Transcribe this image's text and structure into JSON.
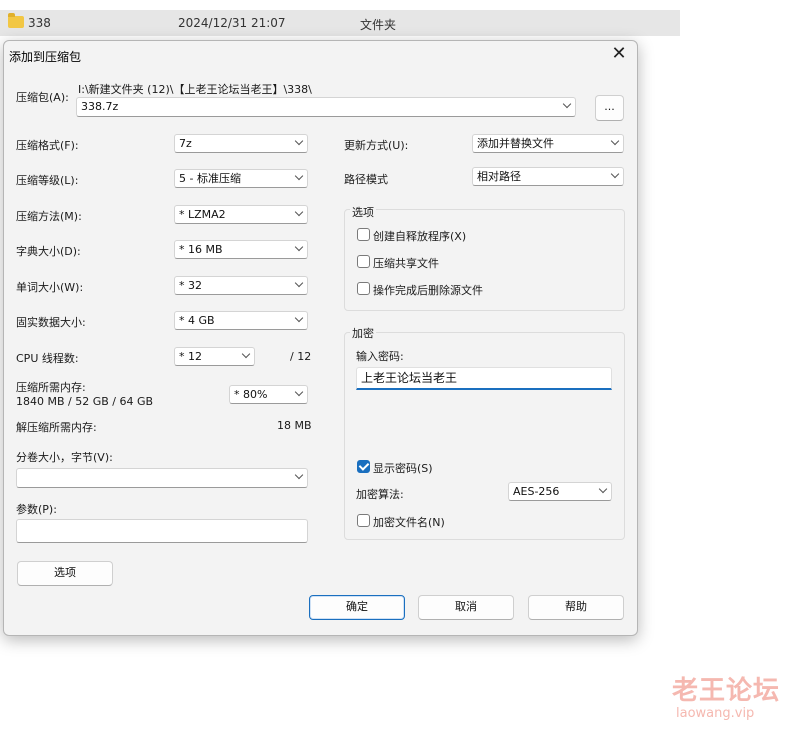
{
  "explorer": {
    "name": "338",
    "date": "2024/12/31 21:07",
    "type": "文件夹"
  },
  "dialog": {
    "title": "添加到压缩包",
    "archive_label": "压缩包(A):",
    "archive_path": "I:\\新建文件夹 (12)\\【上老王论坛当老王】\\338\\",
    "archive_name": "338.7z",
    "browse_label": "...",
    "left": {
      "format_label": "压缩格式(F):",
      "format_value": "7z",
      "level_label": "压缩等级(L):",
      "level_value": "5 - 标准压缩",
      "method_label": "压缩方法(M):",
      "method_value": "* LZMA2",
      "dict_label": "字典大小(D):",
      "dict_value": "* 16 MB",
      "word_label": "单词大小(W):",
      "word_value": "* 32",
      "solid_label": "固实数据大小:",
      "solid_value": "* 4 GB",
      "cpu_label": "CPU 线程数:",
      "cpu_value": "* 12",
      "cpu_total": "/ 12",
      "mem_label": "压缩所需内存:",
      "mem_detail": "1840 MB / 52 GB / 64 GB",
      "mem_value": "* 80%",
      "decomp_label": "解压缩所需内存:",
      "decomp_value": "18 MB",
      "split_label": "分卷大小，字节(V):",
      "split_value": "",
      "params_label": "参数(P):",
      "params_value": "",
      "options_button": "选项"
    },
    "right": {
      "update_label": "更新方式(U):",
      "update_value": "添加并替换文件",
      "path_label": "路径模式",
      "path_value": "相对路径",
      "options_group": "选项",
      "opt_sfx": "创建自释放程序(X)",
      "opt_shared": "压缩共享文件",
      "opt_delete": "操作完成后删除源文件",
      "encrypt_group": "加密",
      "password_label": "输入密码:",
      "password_value": "上老王论坛当老王",
      "show_password": "显示密码(S)",
      "enc_method_label": "加密算法:",
      "enc_method_value": "AES-256",
      "encrypt_names": "加密文件名(N)"
    },
    "buttons": {
      "ok": "确定",
      "cancel": "取消",
      "help": "帮助"
    }
  },
  "watermark": {
    "cn": "老王论坛",
    "en": "laowang.vip"
  },
  "colors": {
    "accent": "#1a6fbf",
    "folder": "#f2c744",
    "watermark": "#f5b8b0"
  }
}
